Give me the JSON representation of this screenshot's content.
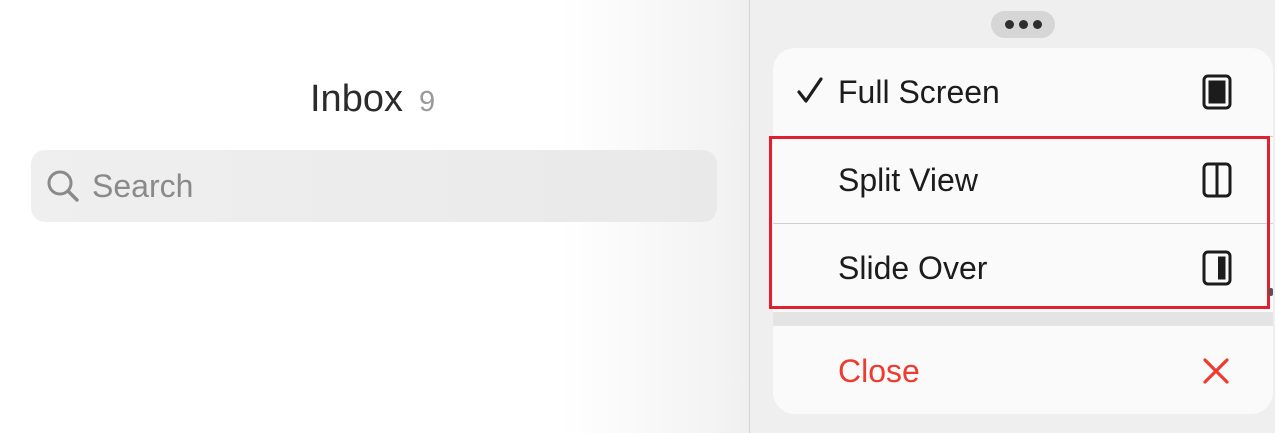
{
  "mail": {
    "title": "Inbox",
    "count": "9",
    "search": {
      "placeholder": "Search",
      "icon": "search-icon"
    }
  },
  "multitasking": {
    "handle_icon": "ellipsis-icon",
    "menu": {
      "items": [
        {
          "label": "Full Screen",
          "checked": true,
          "icon": "full-screen-icon"
        },
        {
          "label": "Split View",
          "checked": false,
          "icon": "split-view-icon"
        },
        {
          "label": "Slide Over",
          "checked": false,
          "icon": "slide-over-icon"
        }
      ],
      "close": {
        "label": "Close",
        "icon": "close-icon",
        "color": "#ee3b2f"
      }
    },
    "highlight_color": "#e0202f"
  }
}
